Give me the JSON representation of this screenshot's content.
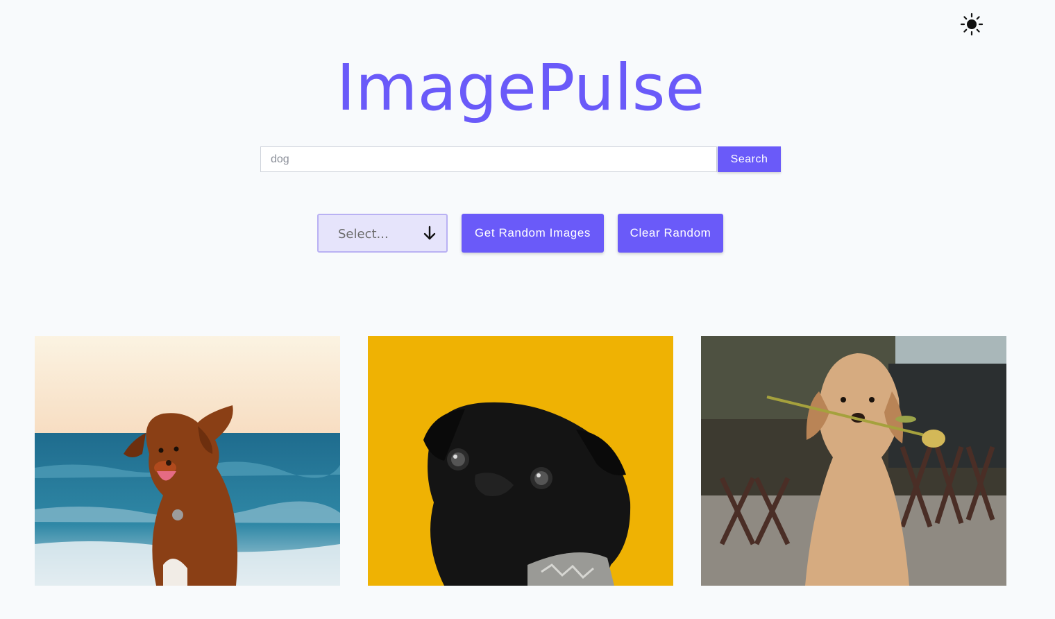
{
  "header": {
    "title": "ImagePulse",
    "theme_toggle_icon": "sun-icon"
  },
  "search": {
    "placeholder": "dog",
    "value": "",
    "button_label": "Search"
  },
  "controls": {
    "select_placeholder": "Select...",
    "select_icon": "arrow-down-icon",
    "random_button_label": "Get Random Images",
    "clear_button_label": "Clear Random"
  },
  "gallery": {
    "images": [
      {
        "subject": "brown dog running on beach"
      },
      {
        "subject": "black pug on yellow background"
      },
      {
        "subject": "golden retriever puppy holding a tulip"
      }
    ]
  },
  "colors": {
    "accent": "#6a5af9",
    "background": "#f8fafc",
    "select_bg": "#e6e4fb"
  }
}
